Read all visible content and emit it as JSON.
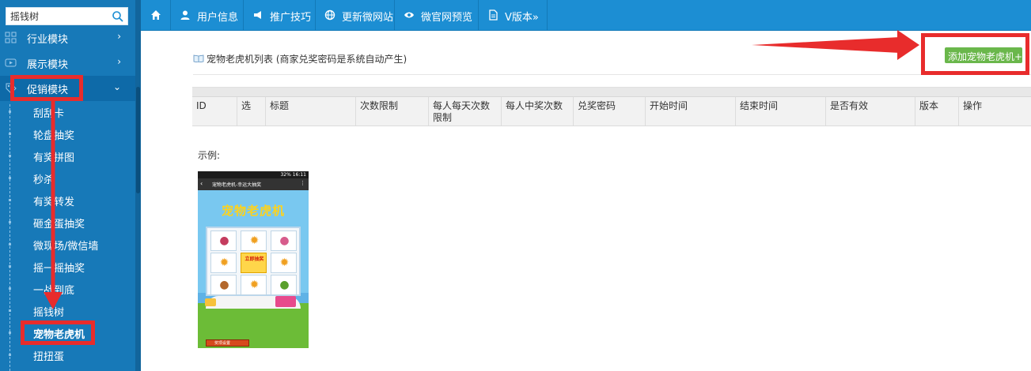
{
  "sidebar": {
    "search_value": "摇钱树",
    "menus": [
      {
        "label": "行业模块",
        "arrow": "›"
      },
      {
        "label": "展示模块",
        "arrow": "›"
      },
      {
        "label": "促销模块",
        "arrow": "⌄"
      }
    ],
    "sub_items": [
      "刮刮卡",
      "轮盘抽奖",
      "有奖拼图",
      "秒杀",
      "有奖转发",
      "砸金蛋抽奖",
      "微现场/微信墙",
      "摇一摇抽奖",
      "一战到底",
      "摇钱树",
      "宠物老虎机",
      "扭扭蛋"
    ]
  },
  "topnav": {
    "items": [
      {
        "label": ""
      },
      {
        "label": "用户信息"
      },
      {
        "label": "推广技巧"
      },
      {
        "label": "更新微网站"
      },
      {
        "label": "微官网预览"
      },
      {
        "label": "V版本»"
      }
    ]
  },
  "main": {
    "page_title": "宠物老虎机列表 (商家兑奖密码是系统自动产生)",
    "add_button": "添加宠物老虎机+",
    "table_headers": [
      "ID",
      "选",
      "标题",
      "次数限制",
      "每人每天次数限制",
      "每人中奖次数",
      "兑奖密码",
      "开始时间",
      "结束时间",
      "是否有效",
      "版本",
      "操作"
    ],
    "example_label": "示例:"
  },
  "phone": {
    "status": "32% 16:11",
    "header_title": "宠物老虎机-幸运大抽奖",
    "logo_text": "宠物老虎机",
    "center_text": "立即抽奖",
    "bottom_btn": "奖项设置"
  },
  "colors": {
    "sidebar_bg": "#1779b8",
    "topnav_bg": "#1c8ed3",
    "add_button": "#6ab74b",
    "annotation": "#e82c2c"
  }
}
